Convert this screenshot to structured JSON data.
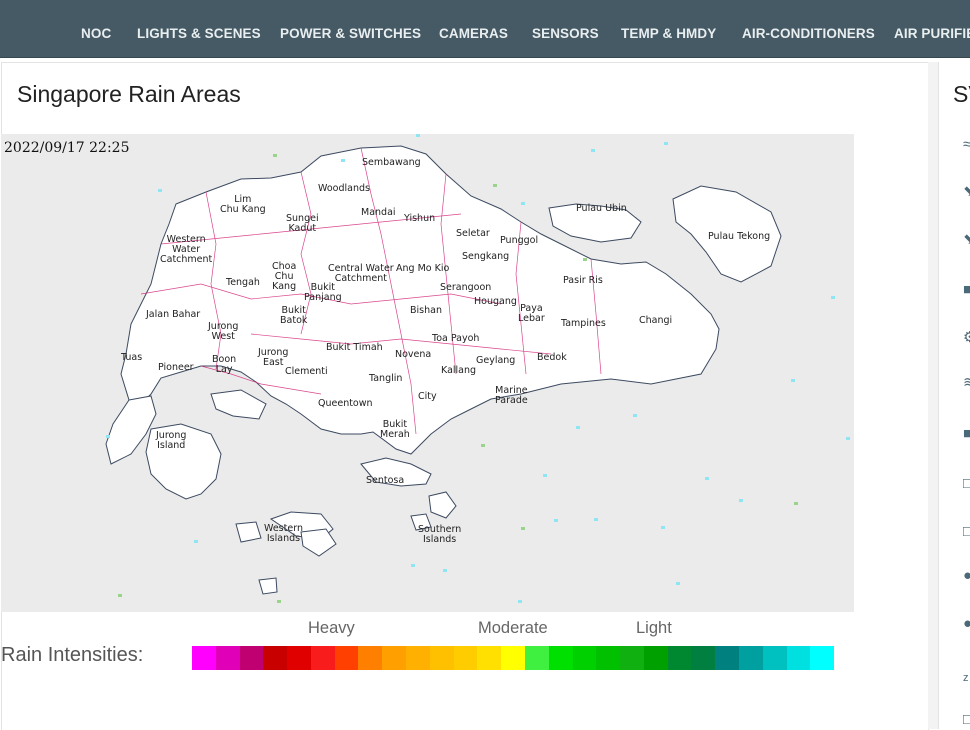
{
  "nav": {
    "items": [
      {
        "label": "NOC"
      },
      {
        "label": "LIGHTS & SCENES"
      },
      {
        "label": "POWER & SWITCHES"
      },
      {
        "label": "CAMERAS"
      },
      {
        "label": "SENSORS"
      },
      {
        "label": "TEMP & HMDY"
      },
      {
        "label": "AIR-CONDITIONERS"
      },
      {
        "label": "AIR PURIFIE"
      }
    ]
  },
  "rain_card": {
    "title": "Singapore Rain Areas",
    "timestamp": "2022/09/17 22:25",
    "map_labels": [
      "Sembawang",
      "Woodlands",
      "Lim Chu Kang",
      "Mandai",
      "Yishun",
      "Pulau Ubin",
      "Pulau Tekong",
      "Sungei Kadut",
      "Western Water Catchment",
      "Seletar",
      "Punggol",
      "Sengkang",
      "Central Water Catchment",
      "Ang Mo Kio",
      "Choa Chu Kang",
      "Tengah",
      "Bukit Panjang",
      "Serangoon",
      "Hougang",
      "Pasir Ris",
      "Bukit Batok",
      "Jalan Bahar",
      "Jurong West",
      "Bishan",
      "Paya Lebar",
      "Tampines",
      "Changi",
      "Toa Payoh",
      "Bukit Timah",
      "Novena",
      "Geylang",
      "Bedok",
      "Tuas",
      "Boon Lay",
      "Pioneer",
      "Jurong East",
      "Clementi",
      "Tanglin",
      "Kallang",
      "Marine Parade",
      "City",
      "Queentown",
      "Bukit Merah",
      "Jurong Island",
      "Sentosa",
      "Western Islands",
      "Southern Islands"
    ],
    "legend": {
      "title": "Rain Intensities:",
      "heavy_label": "Heavy",
      "moderate_label": "Moderate",
      "light_label": "Light",
      "colors": [
        "#ff00ff",
        "#e000b8",
        "#c00070",
        "#c80000",
        "#e00000",
        "#f81c1c",
        "#ff4000",
        "#ff8000",
        "#ffa000",
        "#ffb000",
        "#ffc000",
        "#ffcc00",
        "#ffe000",
        "#ffff00",
        "#40f040",
        "#00e000",
        "#00d000",
        "#00c000",
        "#10b010",
        "#00a000",
        "#008830",
        "#007f40",
        "#00807f",
        "#00a0a0",
        "#00c0c0",
        "#00e0e0",
        "#00ffff"
      ]
    }
  },
  "side_card": {
    "title": "SV"
  }
}
